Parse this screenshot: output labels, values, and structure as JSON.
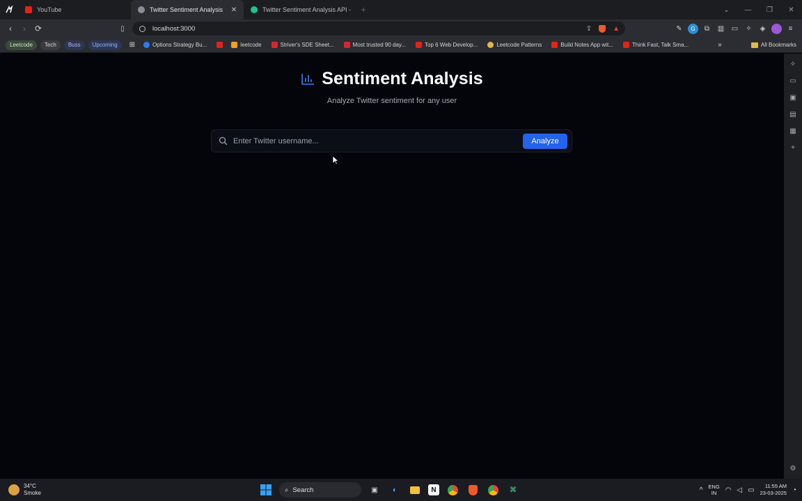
{
  "browser": {
    "tabs": [
      {
        "title": "YouTube",
        "favicon_color": "#e62117"
      },
      {
        "title": "Twitter Sentiment Analysis",
        "favicon_color": "#a0a0a0"
      },
      {
        "title": "Twitter Sentiment Analysis API - Sw...",
        "favicon_color": "#1ec28b"
      }
    ],
    "new_tab_icon": "plus-icon",
    "url": "localhost:3000",
    "bookmarks": {
      "chips": [
        {
          "label": "Leetcode",
          "bg": "#3a4a3a",
          "color": "#cfe3cf"
        },
        {
          "label": "Tech",
          "bg": "#3b3c40",
          "color": "#d9d9d9"
        },
        {
          "label": "Buss",
          "bg": "#2f3550",
          "color": "#aebbf0"
        },
        {
          "label": "Upcoming",
          "bg": "#2b3757",
          "color": "#9ab6f5"
        }
      ],
      "items": [
        {
          "label": "Options Strategy Bu...",
          "color": "#2f7bf0"
        },
        {
          "label": "",
          "color": "#e62117"
        },
        {
          "label": "leetcode",
          "color": "#f0a020"
        },
        {
          "label": "Striver's SDE Sheet...",
          "color": "#d8262e"
        },
        {
          "label": "Most trusted 90 day...",
          "color": "#d8262e"
        },
        {
          "label": "Top 6 Web Develop...",
          "color": "#e62117"
        },
        {
          "label": "Leetcode Patterns",
          "color": "#e0b84c"
        },
        {
          "label": "Build Notes App wit...",
          "color": "#e62117"
        },
        {
          "label": "Think Fast, Talk Sma...",
          "color": "#e62117"
        }
      ],
      "all_bookmarks": "All Bookmarks"
    }
  },
  "page": {
    "title": "Sentiment Analysis",
    "subtitle": "Analyze Twitter sentiment for any user",
    "search": {
      "placeholder": "Enter Twitter username...",
      "value": ""
    },
    "analyze_button": "Analyze",
    "accent": "#2463eb"
  },
  "taskbar": {
    "weather": {
      "temp": "34°C",
      "condition": "Smoke"
    },
    "search_label": "Search",
    "language": {
      "line1": "ENG",
      "line2": "IN"
    },
    "time": "11:55 AM",
    "date": "23-03-2025"
  }
}
